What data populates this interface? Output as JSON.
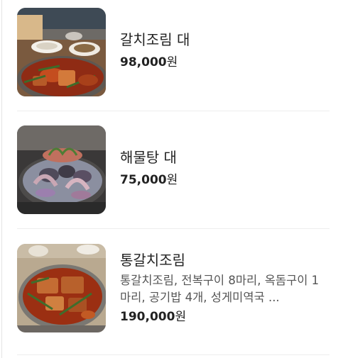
{
  "menu": {
    "items": [
      {
        "name": "갈치조림 대",
        "price": "98,000",
        "currency": "원",
        "photo": "braised-cutlassfish-photo"
      },
      {
        "name": "해물탕 대",
        "price": "75,000",
        "currency": "원",
        "photo": "seafood-stew-photo"
      },
      {
        "name": "통갈치조림",
        "description": "통갈치조림, 전복구이 8마리, 옥돔구이 1마리, 공기밥 4개, 성게미역국 ...",
        "price": "190,000",
        "currency": "원",
        "photo": "whole-cutlassfish-braise-photo"
      }
    ]
  }
}
